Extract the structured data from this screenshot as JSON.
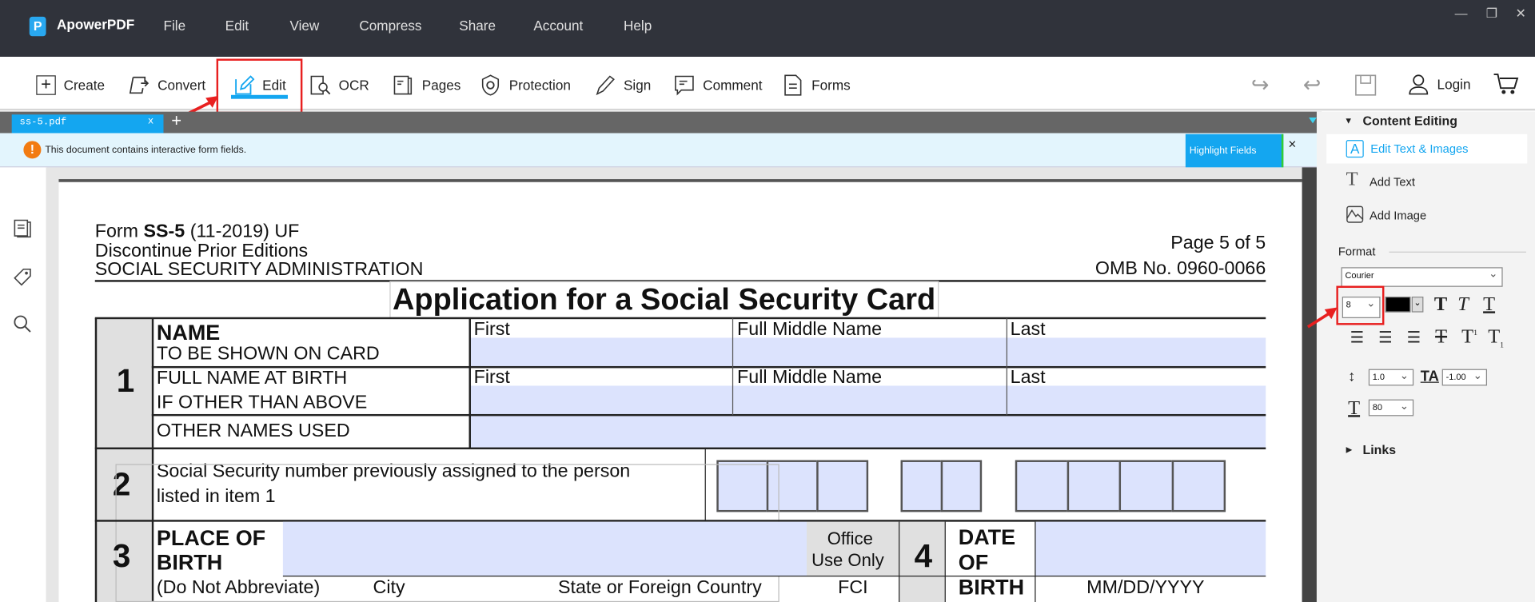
{
  "app": {
    "name": "ApowerPDF",
    "logo_letter": "P"
  },
  "menu": [
    "File",
    "Edit",
    "View",
    "Compress",
    "Share",
    "Account",
    "Help"
  ],
  "window_controls": [
    "minimize",
    "restore",
    "close"
  ],
  "toolbar": {
    "items": [
      {
        "label": "Create",
        "icon": "plus-square-icon"
      },
      {
        "label": "Convert",
        "icon": "convert-icon"
      },
      {
        "label": "Edit",
        "icon": "pencil-edit-icon",
        "active": true
      },
      {
        "label": "OCR",
        "icon": "ocr-scan-icon"
      },
      {
        "label": "Pages",
        "icon": "pages-icon"
      },
      {
        "label": "Protection",
        "icon": "shield-icon"
      },
      {
        "label": "Sign",
        "icon": "pen-icon"
      },
      {
        "label": "Comment",
        "icon": "comment-icon"
      },
      {
        "label": "Forms",
        "icon": "forms-icon"
      }
    ],
    "login_label": "Login",
    "accent": "#14a6f0",
    "highlight_color": "#e82020"
  },
  "tabs": [
    {
      "label": "ss-5.pdf",
      "close": "x"
    }
  ],
  "new_tab": "+",
  "notice": {
    "text": "This document contains interactive form fields.",
    "button": "Highlight Fields",
    "close": "×"
  },
  "document": {
    "header": {
      "form_prefix": "Form ",
      "form_id": "SS-5",
      "form_suffix": " (11-2019) UF",
      "line2": "Discontinue Prior Editions",
      "line3": "SOCIAL SECURITY ADMINISTRATION",
      "page": "Page 5 of 5",
      "omb": "OMB No. 0960-0066"
    },
    "title": "Application for a Social Security Card",
    "item1": {
      "num": "1",
      "name": "NAME",
      "name_sub": "TO BE SHOWN ON CARD",
      "birth": "FULL NAME AT BIRTH",
      "birth_sub": "IF OTHER THAN ABOVE",
      "other": "OTHER NAMES USED",
      "first": "First",
      "middle": "Full Middle Name",
      "last": "Last"
    },
    "item2": {
      "num": "2",
      "line1": "Social Security number previously assigned to the person",
      "line2": "listed in item 1"
    },
    "item3": {
      "num": "3",
      "label1": "PLACE OF",
      "label2": "BIRTH",
      "note": "(Do Not Abbreviate)",
      "city": "City",
      "state": "State or Foreign Country",
      "office1": "Office",
      "office2": "Use Only",
      "fci": "FCI"
    },
    "item4": {
      "num": "4",
      "l1": "DATE",
      "l2": "OF",
      "l3": "BIRTH",
      "format": "MM/DD/YYYY"
    }
  },
  "panel": {
    "content_editing": "Content Editing",
    "edit_text_images": "Edit Text & Images",
    "add_text": "Add Text",
    "add_image": "Add Image",
    "format": "Format",
    "font": "Courier",
    "size": "8",
    "color": "#000000",
    "line_spacing": "1.0",
    "char_spacing": "-1.00",
    "scale": "80",
    "links": "Links"
  }
}
